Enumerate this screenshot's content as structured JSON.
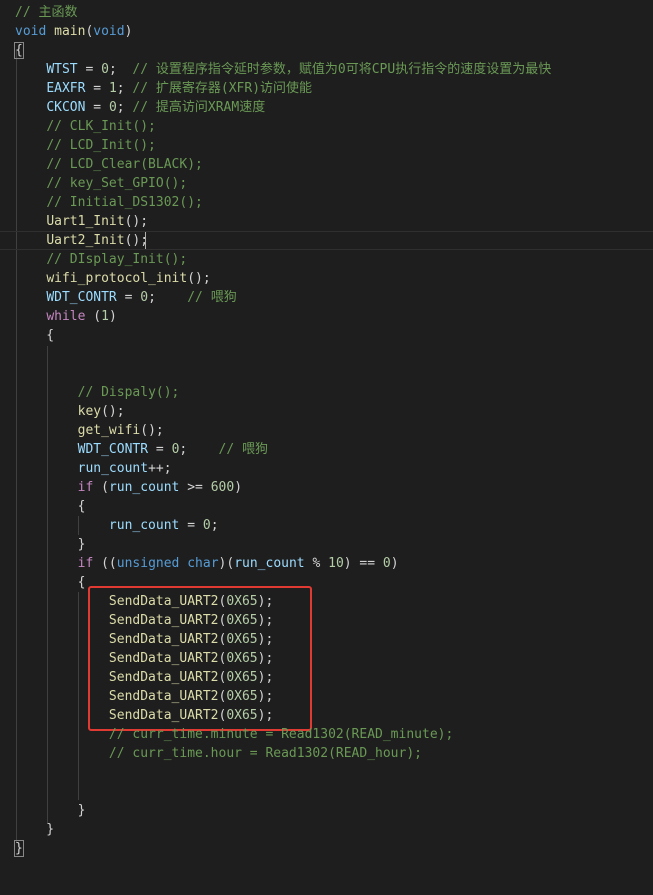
{
  "editor": {
    "language": "c",
    "theme_colors": {
      "background": "#1e1e1e",
      "comment": "#6a9955",
      "keyword": "#569cd6",
      "control": "#c586c0",
      "identifier": "#9cdcfe",
      "function": "#dcdcaa",
      "number": "#b5cea8",
      "text": "#d4d4d4",
      "annotation_box": "#e03a33"
    },
    "lines": [
      [
        {
          "t": "comment",
          "v": "// 主函数"
        }
      ],
      [
        {
          "t": "keyword",
          "v": "void"
        },
        {
          "t": "plain",
          "v": " "
        },
        {
          "t": "func",
          "v": "main"
        },
        {
          "t": "plain",
          "v": "("
        },
        {
          "t": "keyword",
          "v": "void"
        },
        {
          "t": "plain",
          "v": ")"
        }
      ],
      [
        {
          "t": "bracket",
          "v": "{"
        }
      ],
      [
        {
          "t": "plain",
          "v": "    "
        },
        {
          "t": "ident",
          "v": "WTST"
        },
        {
          "t": "plain",
          "v": " = "
        },
        {
          "t": "number",
          "v": "0"
        },
        {
          "t": "plain",
          "v": ";  "
        },
        {
          "t": "comment",
          "v": "// 设置程序指令延时参数，赋值为0可将CPU执行指令的速度设置为最快"
        }
      ],
      [
        {
          "t": "plain",
          "v": "    "
        },
        {
          "t": "ident",
          "v": "EAXFR"
        },
        {
          "t": "plain",
          "v": " = "
        },
        {
          "t": "number",
          "v": "1"
        },
        {
          "t": "plain",
          "v": "; "
        },
        {
          "t": "comment",
          "v": "// 扩展寄存器(XFR)访问使能"
        }
      ],
      [
        {
          "t": "plain",
          "v": "    "
        },
        {
          "t": "ident",
          "v": "CKCON"
        },
        {
          "t": "plain",
          "v": " = "
        },
        {
          "t": "number",
          "v": "0"
        },
        {
          "t": "plain",
          "v": "; "
        },
        {
          "t": "comment",
          "v": "// 提高访问XRAM速度"
        }
      ],
      [
        {
          "t": "plain",
          "v": "    "
        },
        {
          "t": "comment",
          "v": "// CLK_Init();"
        }
      ],
      [
        {
          "t": "plain",
          "v": "    "
        },
        {
          "t": "comment",
          "v": "// LCD_Init();"
        }
      ],
      [
        {
          "t": "plain",
          "v": "    "
        },
        {
          "t": "comment",
          "v": "// LCD_Clear(BLACK);"
        }
      ],
      [
        {
          "t": "plain",
          "v": "    "
        },
        {
          "t": "comment",
          "v": "// key_Set_GPIO();"
        }
      ],
      [
        {
          "t": "plain",
          "v": "    "
        },
        {
          "t": "comment",
          "v": "// Initial_DS1302();"
        }
      ],
      [
        {
          "t": "plain",
          "v": "    "
        },
        {
          "t": "func",
          "v": "Uart1_Init"
        },
        {
          "t": "plain",
          "v": "();"
        }
      ],
      [
        {
          "t": "plain",
          "v": "    "
        },
        {
          "t": "func",
          "v": "Uart2_Init"
        },
        {
          "t": "plain",
          "v": "();"
        }
      ],
      [
        {
          "t": "plain",
          "v": "    "
        },
        {
          "t": "comment",
          "v": "// DIsplay_Init();"
        }
      ],
      [
        {
          "t": "plain",
          "v": "    "
        },
        {
          "t": "func",
          "v": "wifi_protocol_init"
        },
        {
          "t": "plain",
          "v": "();"
        }
      ],
      [
        {
          "t": "plain",
          "v": "    "
        },
        {
          "t": "ident",
          "v": "WDT_CONTR"
        },
        {
          "t": "plain",
          "v": " = "
        },
        {
          "t": "number",
          "v": "0"
        },
        {
          "t": "plain",
          "v": ";    "
        },
        {
          "t": "comment",
          "v": "// 喂狗"
        }
      ],
      [
        {
          "t": "plain",
          "v": "    "
        },
        {
          "t": "control",
          "v": "while"
        },
        {
          "t": "plain",
          "v": " ("
        },
        {
          "t": "number",
          "v": "1"
        },
        {
          "t": "plain",
          "v": ")"
        }
      ],
      [
        {
          "t": "plain",
          "v": "    {"
        }
      ],
      [],
      [],
      [
        {
          "t": "plain",
          "v": "        "
        },
        {
          "t": "comment",
          "v": "// Dispaly();"
        }
      ],
      [
        {
          "t": "plain",
          "v": "        "
        },
        {
          "t": "func",
          "v": "key"
        },
        {
          "t": "plain",
          "v": "();"
        }
      ],
      [
        {
          "t": "plain",
          "v": "        "
        },
        {
          "t": "func",
          "v": "get_wifi"
        },
        {
          "t": "plain",
          "v": "();"
        }
      ],
      [
        {
          "t": "plain",
          "v": "        "
        },
        {
          "t": "ident",
          "v": "WDT_CONTR"
        },
        {
          "t": "plain",
          "v": " = "
        },
        {
          "t": "number",
          "v": "0"
        },
        {
          "t": "plain",
          "v": ";    "
        },
        {
          "t": "comment",
          "v": "// 喂狗"
        }
      ],
      [
        {
          "t": "plain",
          "v": "        "
        },
        {
          "t": "ident",
          "v": "run_count"
        },
        {
          "t": "plain",
          "v": "++;"
        }
      ],
      [
        {
          "t": "plain",
          "v": "        "
        },
        {
          "t": "control",
          "v": "if"
        },
        {
          "t": "plain",
          "v": " ("
        },
        {
          "t": "ident",
          "v": "run_count"
        },
        {
          "t": "plain",
          "v": " >= "
        },
        {
          "t": "number",
          "v": "600"
        },
        {
          "t": "plain",
          "v": ")"
        }
      ],
      [
        {
          "t": "plain",
          "v": "        {"
        }
      ],
      [
        {
          "t": "plain",
          "v": "            "
        },
        {
          "t": "ident",
          "v": "run_count"
        },
        {
          "t": "plain",
          "v": " = "
        },
        {
          "t": "number",
          "v": "0"
        },
        {
          "t": "plain",
          "v": ";"
        }
      ],
      [
        {
          "t": "plain",
          "v": "        }"
        }
      ],
      [
        {
          "t": "plain",
          "v": "        "
        },
        {
          "t": "control",
          "v": "if"
        },
        {
          "t": "plain",
          "v": " (("
        },
        {
          "t": "keyword",
          "v": "unsigned"
        },
        {
          "t": "plain",
          "v": " "
        },
        {
          "t": "keyword",
          "v": "char"
        },
        {
          "t": "plain",
          "v": ")("
        },
        {
          "t": "ident",
          "v": "run_count"
        },
        {
          "t": "plain",
          "v": " % "
        },
        {
          "t": "number",
          "v": "10"
        },
        {
          "t": "plain",
          "v": ") == "
        },
        {
          "t": "number",
          "v": "0"
        },
        {
          "t": "plain",
          "v": ")"
        }
      ],
      [
        {
          "t": "plain",
          "v": "        {"
        }
      ],
      [
        {
          "t": "plain",
          "v": "            "
        },
        {
          "t": "func",
          "v": "SendData_UART2"
        },
        {
          "t": "plain",
          "v": "("
        },
        {
          "t": "number",
          "v": "0X65"
        },
        {
          "t": "plain",
          "v": ");"
        }
      ],
      [
        {
          "t": "plain",
          "v": "            "
        },
        {
          "t": "func",
          "v": "SendData_UART2"
        },
        {
          "t": "plain",
          "v": "("
        },
        {
          "t": "number",
          "v": "0X65"
        },
        {
          "t": "plain",
          "v": ");"
        }
      ],
      [
        {
          "t": "plain",
          "v": "            "
        },
        {
          "t": "func",
          "v": "SendData_UART2"
        },
        {
          "t": "plain",
          "v": "("
        },
        {
          "t": "number",
          "v": "0X65"
        },
        {
          "t": "plain",
          "v": ");"
        }
      ],
      [
        {
          "t": "plain",
          "v": "            "
        },
        {
          "t": "func",
          "v": "SendData_UART2"
        },
        {
          "t": "plain",
          "v": "("
        },
        {
          "t": "number",
          "v": "0X65"
        },
        {
          "t": "plain",
          "v": ");"
        }
      ],
      [
        {
          "t": "plain",
          "v": "            "
        },
        {
          "t": "func",
          "v": "SendData_UART2"
        },
        {
          "t": "plain",
          "v": "("
        },
        {
          "t": "number",
          "v": "0X65"
        },
        {
          "t": "plain",
          "v": ");"
        }
      ],
      [
        {
          "t": "plain",
          "v": "            "
        },
        {
          "t": "func",
          "v": "SendData_UART2"
        },
        {
          "t": "plain",
          "v": "("
        },
        {
          "t": "number",
          "v": "0X65"
        },
        {
          "t": "plain",
          "v": ");"
        }
      ],
      [
        {
          "t": "plain",
          "v": "            "
        },
        {
          "t": "func",
          "v": "SendData_UART2"
        },
        {
          "t": "plain",
          "v": "("
        },
        {
          "t": "number",
          "v": "0X65"
        },
        {
          "t": "plain",
          "v": ");"
        }
      ],
      [
        {
          "t": "plain",
          "v": "            "
        },
        {
          "t": "comment",
          "v": "// curr_time.minute = Read1302(READ_minute);"
        }
      ],
      [
        {
          "t": "plain",
          "v": "            "
        },
        {
          "t": "comment",
          "v": "// curr_time.hour = Read1302(READ_hour);"
        }
      ],
      [],
      [],
      [
        {
          "t": "plain",
          "v": "        }"
        }
      ],
      [
        {
          "t": "plain",
          "v": "    }"
        }
      ],
      [
        {
          "t": "bracket",
          "v": "}"
        }
      ]
    ],
    "active_line": 12
  }
}
